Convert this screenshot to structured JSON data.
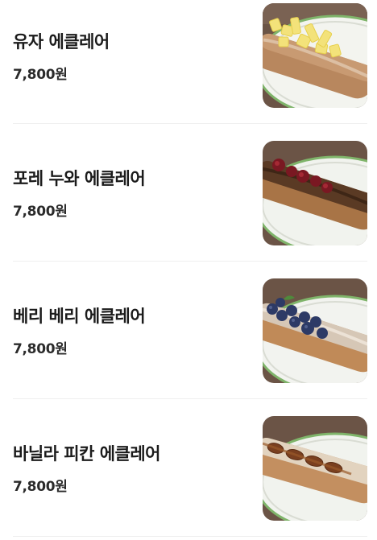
{
  "menu": {
    "items": [
      {
        "name": "유자 에클레어",
        "price": "7,800원",
        "image": "yuzu-eclair-photo",
        "topping": "yuzu"
      },
      {
        "name": "포레 누와 에클레어",
        "price": "7,800원",
        "image": "foret-noire-eclair-photo",
        "topping": "cherry"
      },
      {
        "name": "베리 베리 에클레어",
        "price": "7,800원",
        "image": "berry-berry-eclair-photo",
        "topping": "blueberry"
      },
      {
        "name": "바닐라 피칸 에클레어",
        "price": "7,800원",
        "image": "vanilla-pecan-eclair-photo",
        "topping": "pecan"
      }
    ]
  },
  "colors": {
    "background": "#ffffff",
    "divider": "#efefef",
    "text": "#1b1b1b"
  }
}
